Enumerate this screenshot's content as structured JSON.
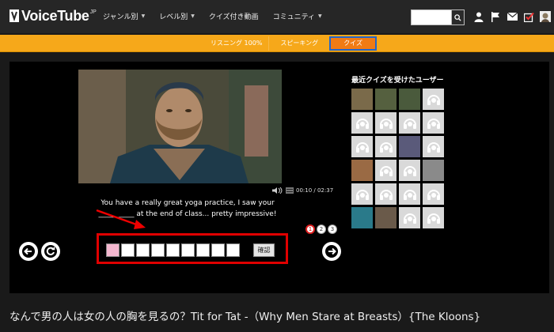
{
  "header": {
    "logo_text": "VoiceTube",
    "logo_sup": "JP",
    "nav": [
      {
        "label": "ジャンル別"
      },
      {
        "label": "レベル別"
      },
      {
        "label": "クイズ付き動画"
      },
      {
        "label": "コミュニティ"
      }
    ],
    "search": {
      "value": "",
      "placeholder": ""
    },
    "icons": [
      "search-icon",
      "user-icon",
      "flag-icon",
      "mail-icon",
      "checkbox-icon",
      "avatar-icon"
    ]
  },
  "tabs": [
    {
      "label": "リスニング 100%"
    },
    {
      "label": "スピーキング"
    },
    {
      "label": "クイズ",
      "active": true
    }
  ],
  "player": {
    "time": "00:10 / 02:37",
    "caption_line1": "You have a really great yoga practice, I saw your",
    "caption_line2": "__________ at the end of class... pretty impressive!"
  },
  "pager": [
    "1",
    "2",
    "3"
  ],
  "quiz": {
    "letter_count": 9,
    "confirm_label": "確認"
  },
  "users": {
    "title": "最近クイズを受けたユーザー",
    "cells": [
      {
        "type": "photo",
        "color": "#7a6a4a"
      },
      {
        "type": "photo",
        "color": "#55603f"
      },
      {
        "type": "photo",
        "color": "#4a5a3c"
      },
      {
        "type": "default"
      },
      {
        "type": "default"
      },
      {
        "type": "default"
      },
      {
        "type": "default"
      },
      {
        "type": "default"
      },
      {
        "type": "default"
      },
      {
        "type": "default"
      },
      {
        "type": "photo",
        "color": "#5a5a7a"
      },
      {
        "type": "default"
      },
      {
        "type": "photo",
        "color": "#9a6a44"
      },
      {
        "type": "default"
      },
      {
        "type": "default"
      },
      {
        "type": "photo",
        "color": "#8a8a8a"
      },
      {
        "type": "default"
      },
      {
        "type": "default"
      },
      {
        "type": "default"
      },
      {
        "type": "default"
      },
      {
        "type": "photo",
        "color": "#2a7a8a"
      },
      {
        "type": "photo",
        "color": "#6a5a4a"
      },
      {
        "type": "default"
      },
      {
        "type": "default"
      }
    ]
  },
  "video_title": "なんで男の人は女の人の胸を見るの？Tit for Tat -（Why Men Stare at Breasts）{The Kloons}"
}
